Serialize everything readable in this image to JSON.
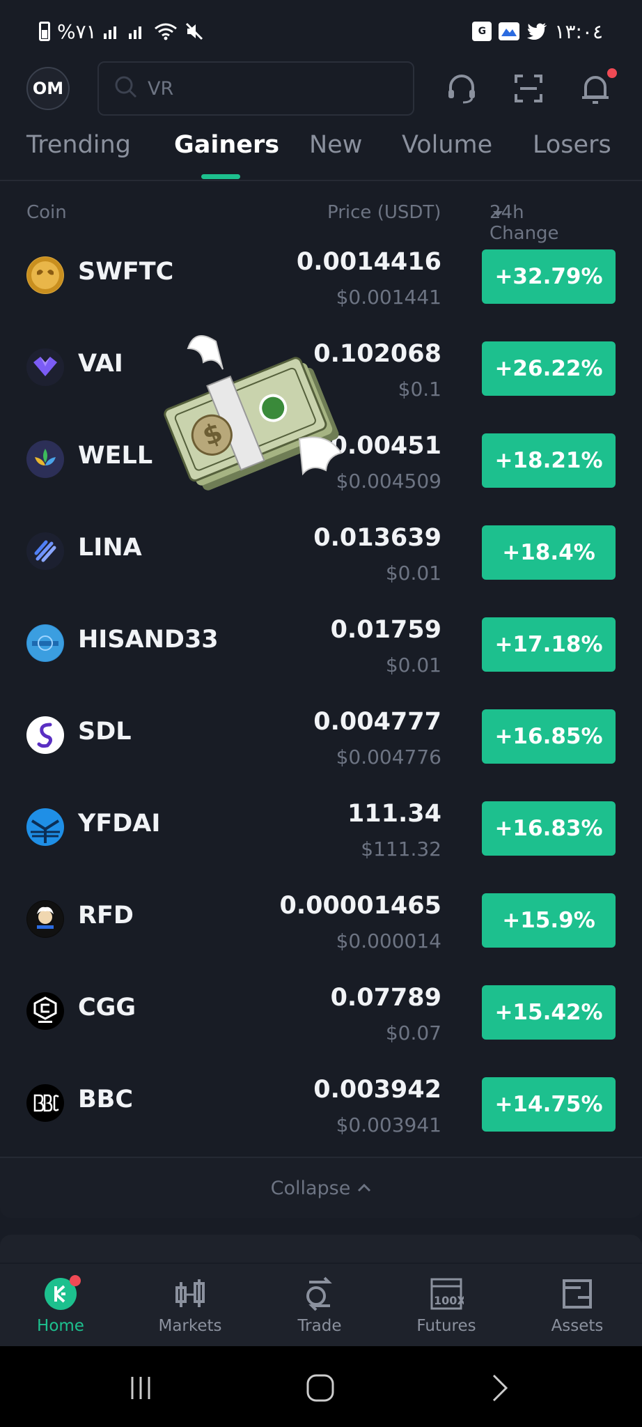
{
  "status_bar": {
    "left_text": "%٧١",
    "time": "١٣:٠٤"
  },
  "header": {
    "avatar_initials": "OM",
    "search_placeholder": "VR"
  },
  "tabs": [
    {
      "label": "Trending",
      "active": false
    },
    {
      "label": "Gainers",
      "active": true
    },
    {
      "label": "New",
      "active": false
    },
    {
      "label": "Volume",
      "active": false
    },
    {
      "label": "Losers",
      "active": false
    }
  ],
  "columns": {
    "coin": "Coin",
    "price": "Price (USDT)",
    "change": "24h Change"
  },
  "rows": [
    {
      "name": "SWFTC",
      "price": "0.0014416",
      "usd": "$0.001441",
      "change": "+32.79%",
      "logo_color": "#d9a53a",
      "logo_icon": "swftc-logo-icon"
    },
    {
      "name": "VAI",
      "price": "0.102068",
      "usd": "$0.1",
      "change": "+26.22%",
      "logo_color": "#7b5cf5",
      "logo_icon": "vai-logo-icon"
    },
    {
      "name": "WELL",
      "price": "0.00451",
      "usd": "$0.004509",
      "change": "+18.21%",
      "logo_color": "#2c2f57",
      "logo_icon": "well-logo-icon"
    },
    {
      "name": "LINA",
      "price": "0.013639",
      "usd": "$0.01",
      "change": "+18.4%",
      "logo_color": "#1c2030",
      "logo_icon": "lina-logo-icon"
    },
    {
      "name": "HISAND33",
      "price": "0.01759",
      "usd": "$0.01",
      "change": "+17.18%",
      "logo_color": "#2f8fd6",
      "logo_icon": "hisand33-logo-icon"
    },
    {
      "name": "SDL",
      "price": "0.004777",
      "usd": "$0.004776",
      "change": "+16.85%",
      "logo_color": "#ffffff",
      "logo_icon": "sdl-logo-icon"
    },
    {
      "name": "YFDAI",
      "price": "111.34",
      "usd": "$111.32",
      "change": "+16.83%",
      "logo_color": "#1f8fe6",
      "logo_icon": "yfdai-logo-icon"
    },
    {
      "name": "RFD",
      "price": "0.00001465",
      "usd": "$0.000014",
      "change": "+15.9%",
      "logo_color": "#0b0b0b",
      "logo_icon": "rfd-logo-icon"
    },
    {
      "name": "CGG",
      "price": "0.07789",
      "usd": "$0.07",
      "change": "+15.42%",
      "logo_color": "#000000",
      "logo_icon": "cgg-logo-icon"
    },
    {
      "name": "BBC",
      "price": "0.003942",
      "usd": "$0.003941",
      "change": "+14.75%",
      "logo_color": "#000000",
      "logo_icon": "bbc-logo-icon"
    }
  ],
  "collapse_label": "Collapse",
  "bottom_nav": [
    {
      "label": "Home",
      "icon": "home-icon",
      "active": true
    },
    {
      "label": "Markets",
      "icon": "markets-icon",
      "active": false
    },
    {
      "label": "Trade",
      "icon": "trade-icon",
      "active": false
    },
    {
      "label": "Futures",
      "icon": "futures-icon",
      "active": false
    },
    {
      "label": "Assets",
      "icon": "assets-icon",
      "active": false
    }
  ],
  "futures_icon_text": "100X",
  "colors": {
    "background": "#181c25",
    "accent_green": "#1dc08e",
    "muted_text": "#6d7483",
    "badge_red": "#f04a55"
  }
}
